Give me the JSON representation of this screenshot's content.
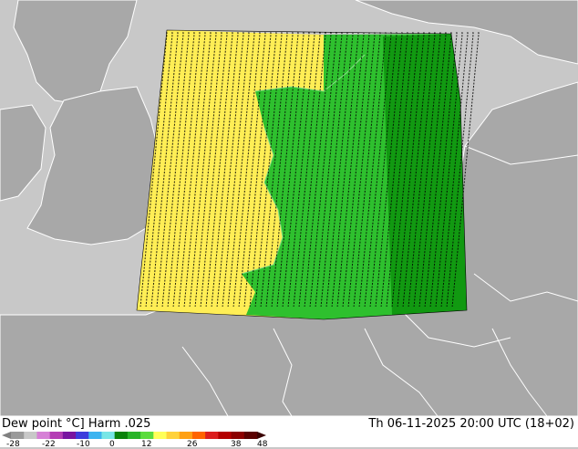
{
  "map": {
    "title": "Dew point °C] Harm .025",
    "timestamp": "Th 06-11-2025 20:00 UTC (18+02)",
    "colors": {
      "sea": "#c8c8c8",
      "land": "#a8a8a8",
      "border": "#ffffff",
      "field_yellow": "#ffee55",
      "field_green": "#2ec02e",
      "field_dark_green": "#119911",
      "contour_black": "#000000"
    },
    "legend": {
      "tick_labels": [
        "-28",
        "-22",
        "-10",
        "0",
        "12",
        "26",
        "38",
        "48"
      ],
      "colors": [
        "#9a9a9a",
        "#c8c8c8",
        "#d680d6",
        "#b43cb4",
        "#7814a0",
        "#3c3cdc",
        "#3cb4f0",
        "#78e6e6",
        "#0a820a",
        "#28b428",
        "#5adc3c",
        "#ffff5a",
        "#ffd23c",
        "#ffa014",
        "#ff6400",
        "#dc1e1e",
        "#b40000",
        "#8c0000",
        "#5a0000"
      ]
    }
  }
}
